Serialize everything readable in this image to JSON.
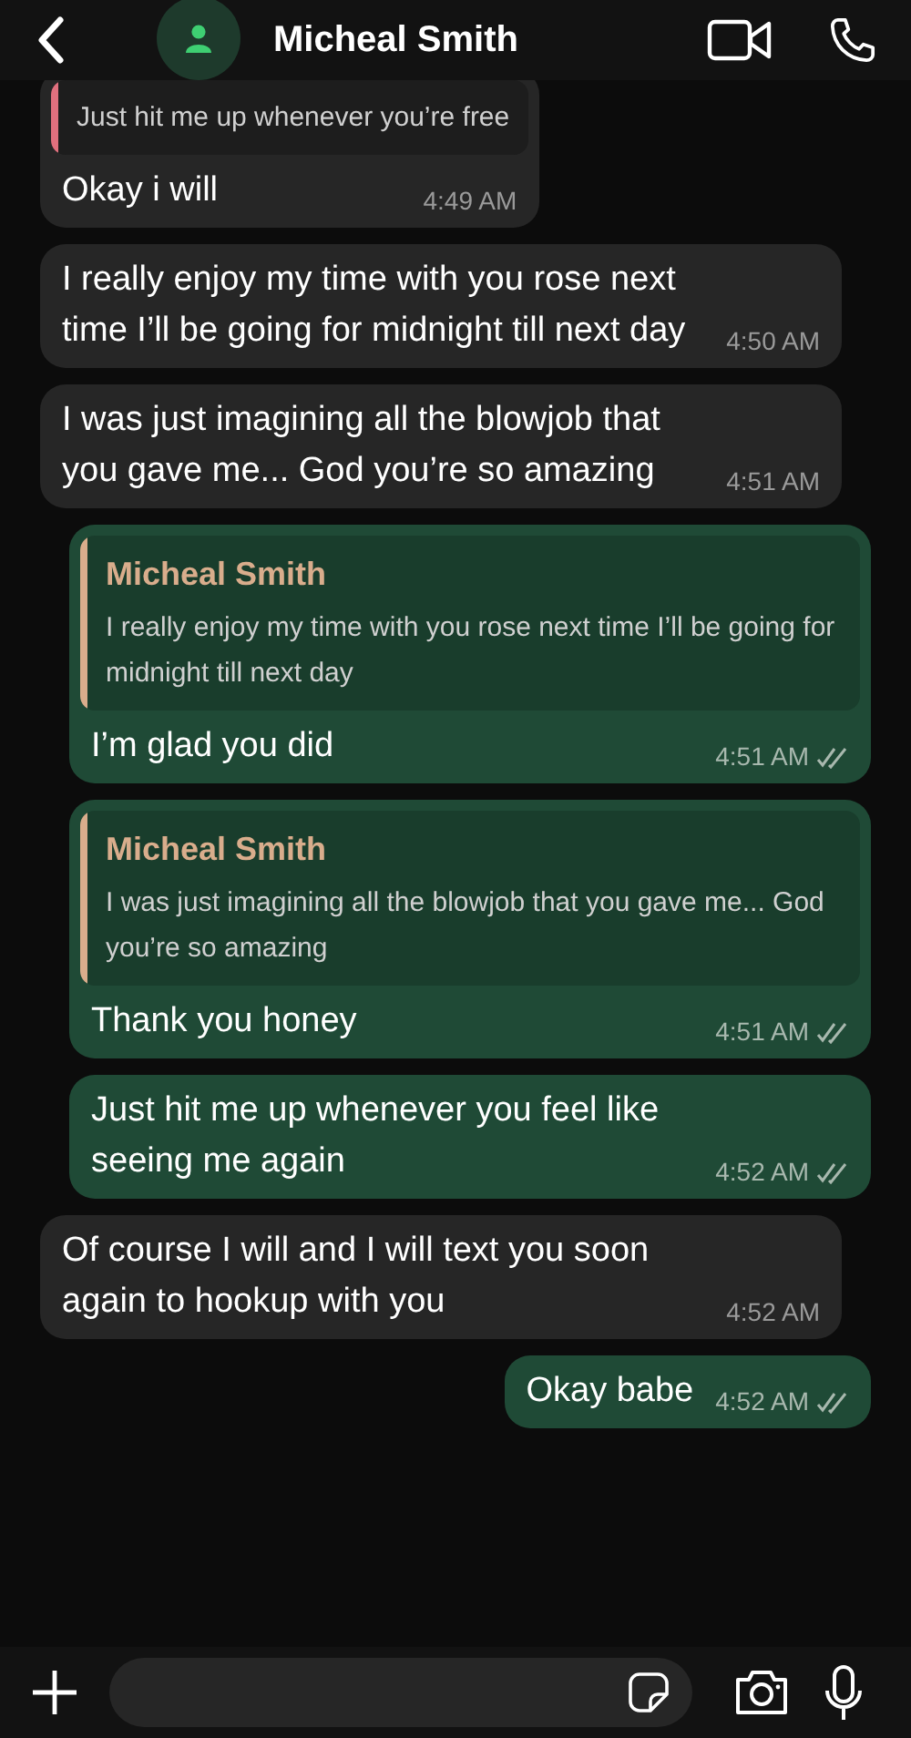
{
  "header": {
    "title": "Micheal Smith"
  },
  "messages": [
    {
      "outgoing": false,
      "quote": {
        "text": "Just hit me up whenever you’re free",
        "color": "#e0707e"
      },
      "text": "Okay i will",
      "time": "4:49 AM"
    },
    {
      "outgoing": false,
      "text": "I really enjoy my time with you rose next time I’ll be going for midnight till next day",
      "time": "4:50 AM"
    },
    {
      "outgoing": false,
      "text": "I was just imagining all the blowjob that you gave me... God you’re so amazing",
      "time": "4:51 AM"
    },
    {
      "outgoing": true,
      "quote": {
        "author": "Micheal Smith",
        "text": "I really enjoy my time with you rose next time I’ll be going for midnight till next day",
        "color": "#d9ad8c"
      },
      "text": "I’m glad you did",
      "time": "4:51 AM"
    },
    {
      "outgoing": true,
      "quote": {
        "author": "Micheal Smith",
        "text": "I was just imagining all the blowjob that you gave me... God you’re so amazing",
        "color": "#d9ad8c"
      },
      "text": "Thank you honey",
      "time": "4:51 AM"
    },
    {
      "outgoing": true,
      "text": "Just hit me up whenever you feel like seeing me again",
      "time": "4:52 AM"
    },
    {
      "outgoing": false,
      "text": "Of course I will and I will text you soon again to hookup with you",
      "time": "4:52 AM"
    },
    {
      "outgoing": true,
      "text": "Okay babe",
      "time": "4:52 AM"
    }
  ]
}
